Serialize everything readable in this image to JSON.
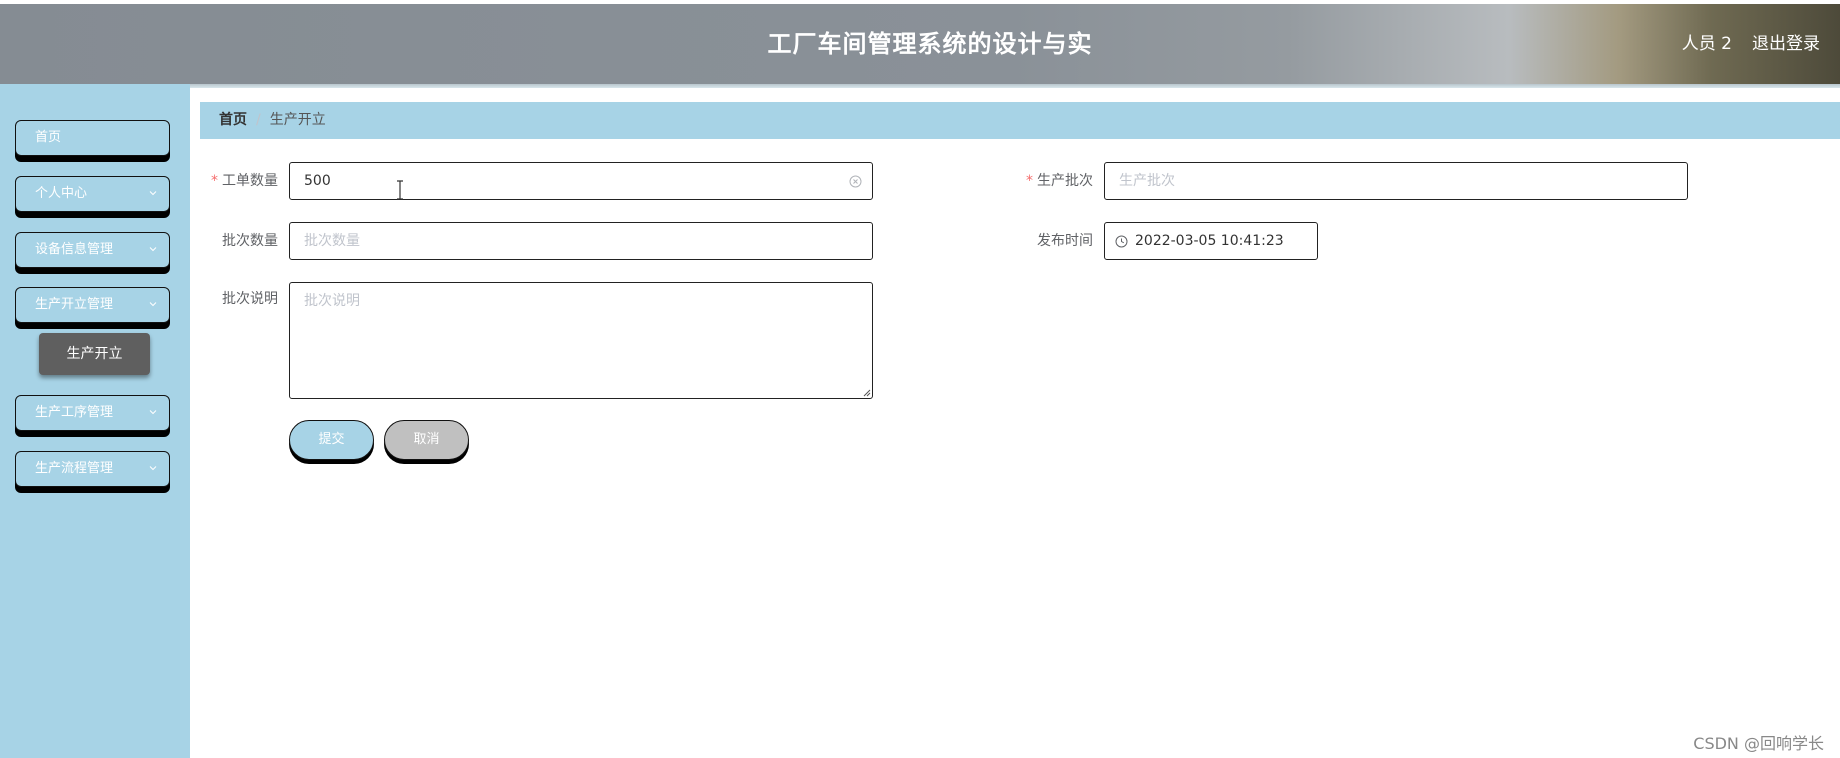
{
  "header": {
    "title": "工厂车间管理系统的设计与实",
    "user": "人员 2",
    "logout": "退出登录"
  },
  "sidebar": {
    "items": [
      {
        "label": "首页",
        "has_submenu": false
      },
      {
        "label": "个人中心",
        "has_submenu": true
      },
      {
        "label": "设备信息管理",
        "has_submenu": true
      },
      {
        "label": "生产开立管理",
        "has_submenu": true,
        "expanded": true
      },
      {
        "label": "生产工序管理",
        "has_submenu": true
      },
      {
        "label": "生产流程管理",
        "has_submenu": true
      }
    ],
    "active_subitem": "生产开立"
  },
  "breadcrumb": {
    "home": "首页",
    "separator": "/",
    "current": "生产开立"
  },
  "form": {
    "work_order_qty": {
      "label": "工单数量",
      "required": true,
      "value": "500"
    },
    "batch_no": {
      "label": "生产批次",
      "required": true,
      "placeholder": "生产批次",
      "value": ""
    },
    "batch_qty": {
      "label": "批次数量",
      "required": false,
      "placeholder": "批次数量",
      "value": ""
    },
    "publish_time": {
      "label": "发布时间",
      "required": false,
      "value": "2022-03-05 10:41:23"
    },
    "batch_desc": {
      "label": "批次说明",
      "required": false,
      "placeholder": "批次说明",
      "value": ""
    },
    "submit_label": "提交",
    "cancel_label": "取消"
  },
  "watermark": "CSDN @回响学长",
  "colors": {
    "accent": "#a7d3e6",
    "required": "#f56c6c",
    "submenu_active": "#5f5f5f"
  }
}
